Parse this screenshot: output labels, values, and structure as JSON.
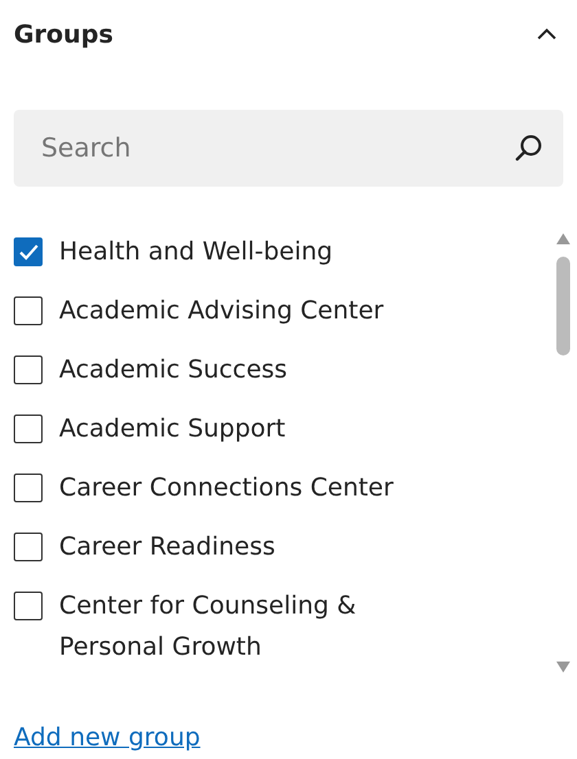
{
  "header": {
    "title": "Groups",
    "expanded": true
  },
  "search": {
    "placeholder": "Search"
  },
  "groups": [
    {
      "label": "Health and Well-being",
      "checked": true
    },
    {
      "label": "Academic Advising Center",
      "checked": false
    },
    {
      "label": "Academic Success",
      "checked": false
    },
    {
      "label": "Academic Support",
      "checked": false
    },
    {
      "label": "Career Connections Center",
      "checked": false
    },
    {
      "label": "Career Readiness",
      "checked": false
    },
    {
      "label": "Center for Counseling & Personal Growth",
      "checked": false
    }
  ],
  "add_link": "Add new group"
}
